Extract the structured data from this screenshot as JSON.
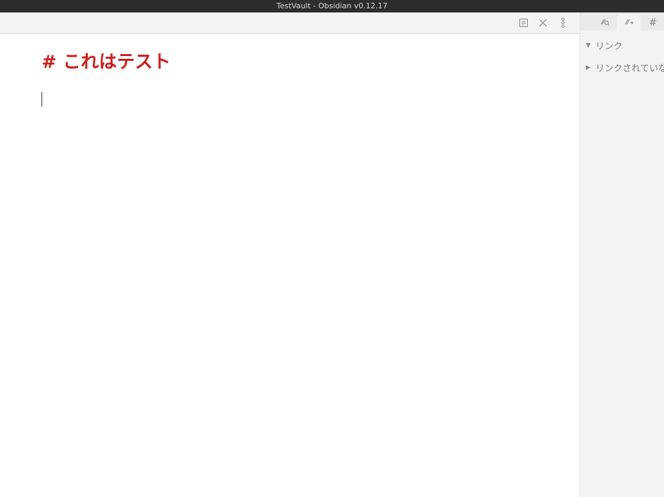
{
  "window": {
    "title": "TestVault - Obsidian v0.12.17"
  },
  "editor": {
    "heading": "# これはテスト"
  },
  "toolbar": {
    "preview_icon": "book-preview-icon",
    "close_icon": "close-icon",
    "more_icon": "more-options-icon"
  },
  "sidebar": {
    "tabs": [
      {
        "icon": "backlinks-icon"
      },
      {
        "icon": "outgoing-links-icon"
      },
      {
        "icon": "#"
      }
    ],
    "sections": [
      {
        "label": "リンク",
        "expanded": true
      },
      {
        "label": "リンクされていない",
        "expanded": false
      }
    ]
  },
  "colors": {
    "heading": "#cc1f1f",
    "titlebar": "#2d2d2d",
    "sidebar_bg": "#f2f3f5"
  }
}
